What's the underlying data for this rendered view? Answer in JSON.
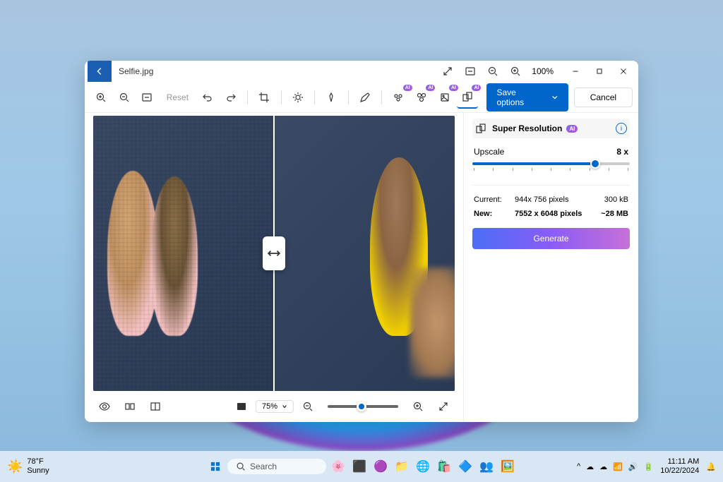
{
  "window": {
    "filename": "Selfie.jpg",
    "zoom_label": "100%"
  },
  "toolbar": {
    "reset": "Reset",
    "ai_badge": "AI",
    "save": "Save options",
    "cancel": "Cancel"
  },
  "panel": {
    "title": "Super Resolution",
    "ai_badge": "AI",
    "upscale_label": "Upscale",
    "upscale_value": "8 x",
    "current_label": "Current:",
    "current_res": "944x 756 pixels",
    "current_size": "300 kB",
    "new_label": "New:",
    "new_res": "7552 x 6048 pixels",
    "new_size": "~28 MB",
    "generate": "Generate"
  },
  "bottom": {
    "zoom_pct": "75%"
  },
  "taskbar": {
    "weather_temp": "78°F",
    "weather_cond": "Sunny",
    "search_placeholder": "Search",
    "time": "11:11 AM",
    "date": "10/22/2024"
  }
}
